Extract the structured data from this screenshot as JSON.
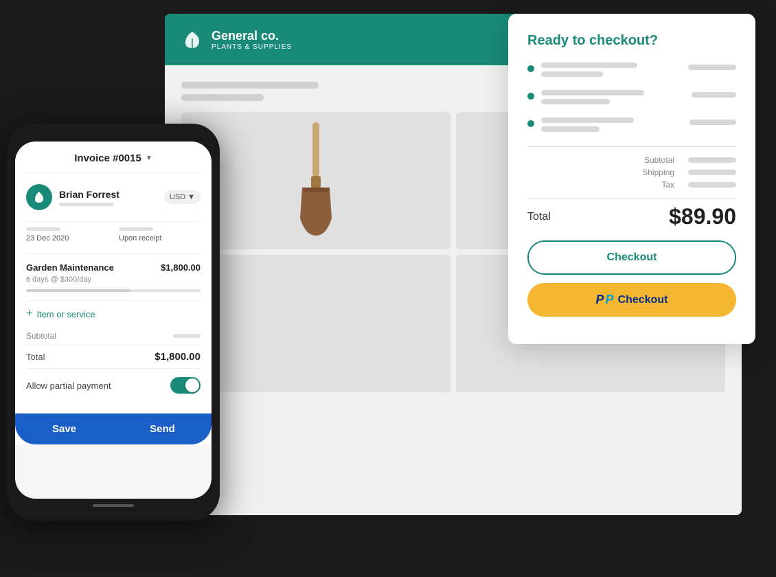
{
  "app": {
    "company": {
      "name": "General co.",
      "subtitle": "PLANTS & SUPPLIES"
    }
  },
  "checkout_modal": {
    "title": "Ready to checkout?",
    "items": [
      {
        "id": 1
      },
      {
        "id": 2
      },
      {
        "id": 3
      }
    ],
    "subtotal_label": "Subtotal",
    "shipping_label": "Shipping",
    "tax_label": "Tax",
    "total_label": "Total",
    "total_amount": "$89.90",
    "checkout_button": "Checkout",
    "paypal_button": "Checkout"
  },
  "invoice": {
    "title": "Invoice #0015",
    "client_name": "Brian Forrest",
    "currency": "USD",
    "date": "23 Dec 2020",
    "payment_terms": "Upon receipt",
    "item_name": "Garden Maintenance",
    "item_price": "$1,800.00",
    "item_desc": "6 days @ $300/day",
    "add_item_label": "Item or service",
    "subtotal_label": "Subtotal",
    "total_label": "Total",
    "total_amount": "$1,800.00",
    "partial_payment_label": "Allow partial payment",
    "save_button": "Save",
    "send_button": "Send"
  }
}
